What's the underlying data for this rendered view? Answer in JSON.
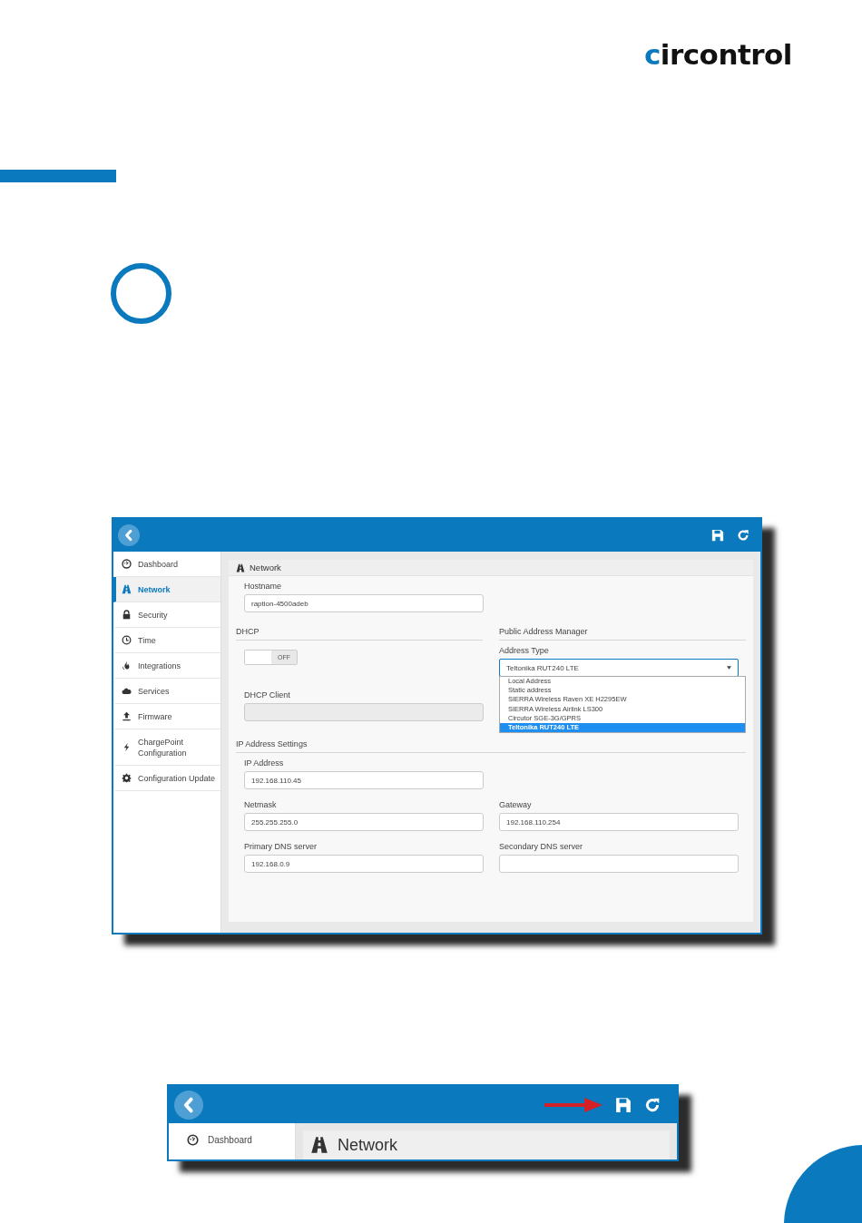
{
  "logo": {
    "text": "circontrol"
  },
  "app": {
    "sidebar": [
      {
        "label": "Dashboard",
        "kind": "gauge",
        "selected": false
      },
      {
        "label": "Network",
        "kind": "road",
        "selected": true
      },
      {
        "label": "Security",
        "kind": "lock",
        "selected": false
      },
      {
        "label": "Time",
        "kind": "clock",
        "selected": false
      },
      {
        "label": "Integrations",
        "kind": "flame",
        "selected": false
      },
      {
        "label": "Services",
        "kind": "cloud",
        "selected": false
      },
      {
        "label": "Firmware",
        "kind": "upload",
        "selected": false
      },
      {
        "label": "ChargePoint Configuration",
        "kind": "bolt",
        "selected": false
      },
      {
        "label": "Configuration Update",
        "kind": "gear",
        "selected": false
      }
    ],
    "panel_title": "Network",
    "hostname": {
      "label": "Hostname",
      "value": "raption-4500adeb"
    },
    "dhcp": {
      "title": "DHCP",
      "toggle": {
        "label": "OFF",
        "on": false
      },
      "client": {
        "label": "DHCP Client",
        "disabled": true
      }
    },
    "public_address": {
      "title": "Public Address Manager",
      "address_type": {
        "label": "Address Type",
        "value": "Teltonika RUT240 LTE",
        "expanded": true,
        "options": [
          {
            "label": "Local Address",
            "selected": false
          },
          {
            "label": "Static address",
            "selected": false
          },
          {
            "label": "SIERRA Wireless Raven XE H2295EW",
            "selected": false
          },
          {
            "label": "SIERRA Wireless Airlink LS300",
            "selected": false
          },
          {
            "label": "Circutor SGE-3G/GPRS",
            "selected": false
          },
          {
            "label": "Teltonika RUT240 LTE",
            "selected": true
          }
        ]
      }
    },
    "ip_settings": {
      "title": "IP Address Settings",
      "rows": [
        [
          {
            "label": "IP Address",
            "value": "192.168.110.45"
          }
        ],
        [
          {
            "label": "Netmask",
            "value": "255.255.255.0"
          },
          {
            "label": "Gateway",
            "value": "192.168.110.254"
          }
        ],
        [
          {
            "label": "Primary DNS server",
            "value": "192.168.0.9"
          },
          {
            "label": "Secondary DNS server"
          }
        ]
      ]
    }
  },
  "detail": {
    "sidebar_item": {
      "label": "Dashboard",
      "kind": "gauge"
    },
    "panel_title": "Network"
  }
}
